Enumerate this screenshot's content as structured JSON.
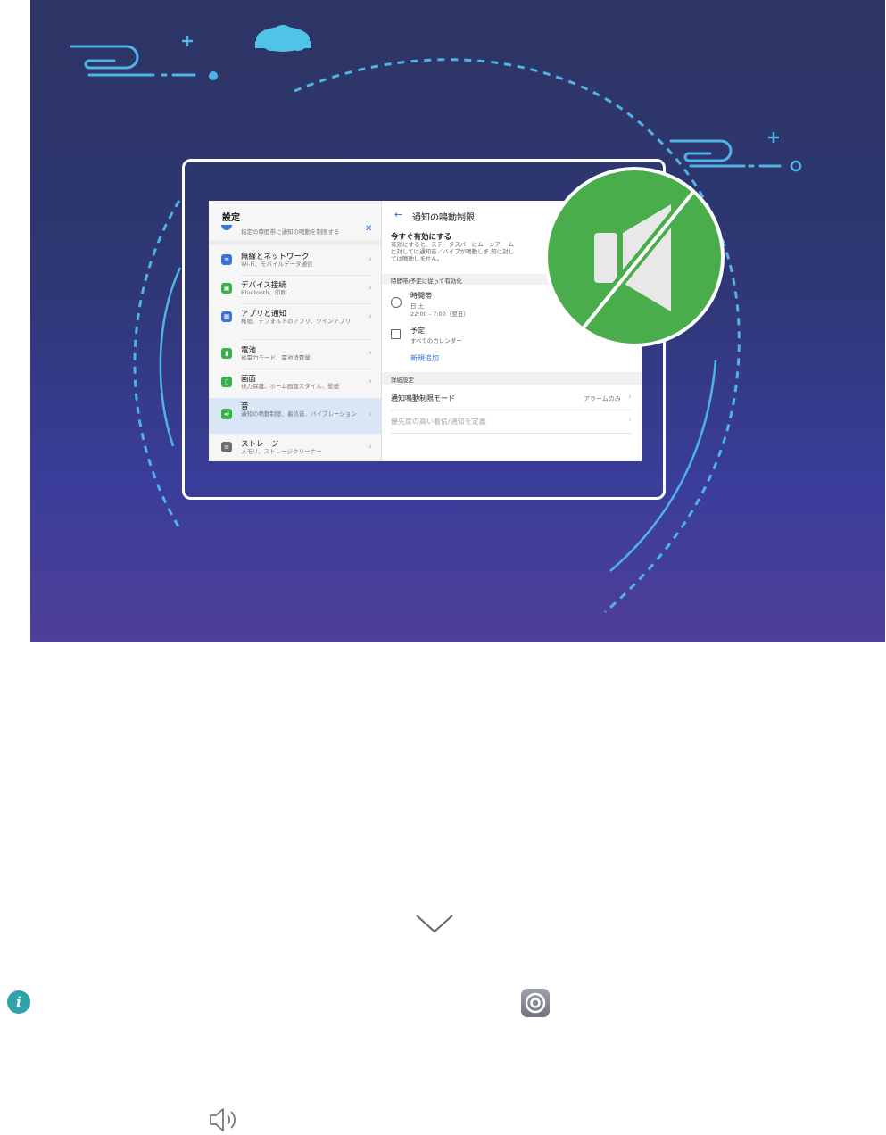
{
  "hero": {
    "colors": {
      "bg_top": "#2d3564",
      "bg_bottom": "#4e3f98",
      "accent": "#4fb3e8",
      "mute_green": "#4aad4c"
    },
    "tablet": {
      "left": {
        "title": "設定",
        "top_partial_sub": "指定の時間帯に通知の鳴動を制限する",
        "items": [
          {
            "title": "無線とネットワーク",
            "sub": "Wi-Fi、モバイルデータ通信",
            "icon": "wifi-icon",
            "color": "#3b73d6"
          },
          {
            "title": "デバイス接続",
            "sub": "Bluetooth、印刷",
            "icon": "device-connect-icon",
            "color": "#38b04a"
          },
          {
            "title": "アプリと通知",
            "sub": "権限、デフォルトのアプリ、ツインアプリ",
            "icon": "apps-icon",
            "color": "#3b73d6"
          },
          {
            "title": "電池",
            "sub": "省電力モード、電池消費量",
            "icon": "battery-icon",
            "color": "#38b04a"
          },
          {
            "title": "画面",
            "sub": "視力保護、ホーム画面スタイル、壁紙",
            "icon": "display-icon",
            "color": "#38b04a"
          },
          {
            "title": "音",
            "sub": "通知の鳴動制限、着信音、バイブレーション",
            "icon": "sound-icon",
            "color": "#38b04a",
            "active": true
          },
          {
            "title": "ストレージ",
            "sub": "メモリ、ストレージクリーナー",
            "icon": "storage-icon",
            "color": "#6e6e6e"
          }
        ]
      },
      "right": {
        "title": "通知の鳴動制限",
        "enable_title": "今すぐ有効にする",
        "enable_desc": "有効にすると、ステータスバーにムーンア ームに対しては通知音／バイブが鳴動しま 知に対しては鳴動しません。",
        "schedule_header": "時間帯/予定に従って有効化",
        "time_title": "時間帯",
        "time_days": "日 土",
        "time_range": "22:00 - 7:00（翌日）",
        "event_title": "予定",
        "event_sub": "すべてのカレンダー",
        "add_new": "新規追加",
        "advanced_header": "詳細設定",
        "mode_label": "通知鳴動制限モード",
        "mode_value": "アラームのみ",
        "priority_label": "優先度の高い着信/通知を定義"
      }
    }
  },
  "icons": {
    "down_chevron": "chevron-down-icon",
    "info": "info-icon",
    "info_glyph": "i",
    "settings": "settings-app-icon",
    "sound": "speaker-icon"
  }
}
